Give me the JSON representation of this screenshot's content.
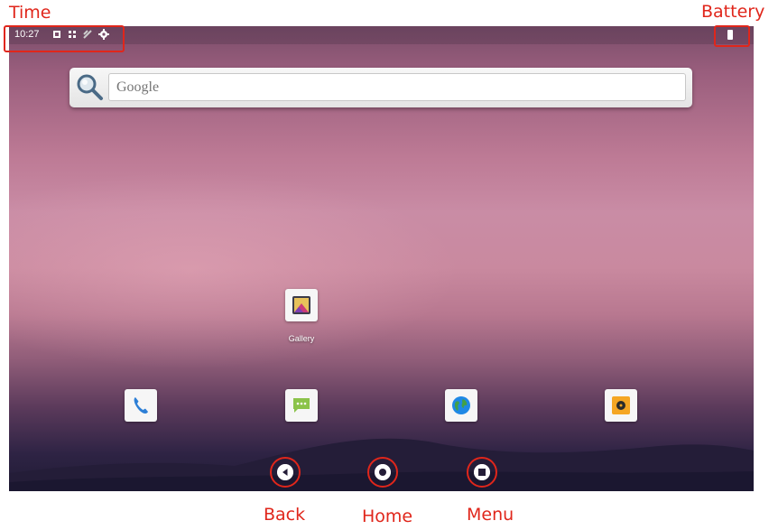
{
  "annotations": {
    "time_label": "Time",
    "battery_label": "Battery",
    "back_label": "Back",
    "home_label": "Home",
    "menu_label": "Menu",
    "color": "#e0261b"
  },
  "status_bar": {
    "time": "10:27",
    "icons": [
      "notification-icon",
      "notification-icon",
      "notification-icon",
      "settings-gear-icon"
    ],
    "battery_icon": "battery-icon"
  },
  "search": {
    "placeholder": "Google",
    "icon": "search-icon"
  },
  "home_apps": [
    {
      "label": "Gallery",
      "icon": "gallery-icon"
    }
  ],
  "dock": [
    {
      "icon": "phone-icon"
    },
    {
      "icon": "messaging-icon"
    },
    {
      "icon": "browser-icon"
    },
    {
      "icon": "music-icon"
    }
  ],
  "nav_bar": {
    "buttons": [
      "back-icon",
      "home-icon",
      "recents-icon"
    ]
  }
}
